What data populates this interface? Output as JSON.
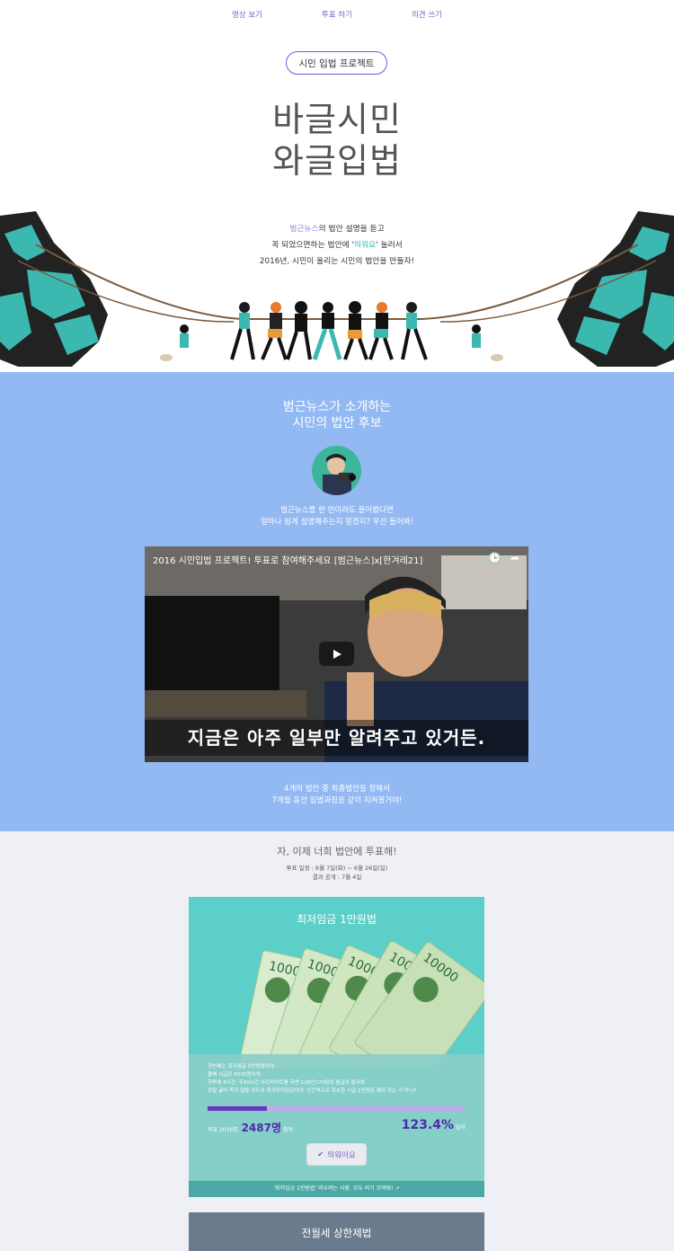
{
  "nav": {
    "items": [
      "영상 보기",
      "투표 하기",
      "의견 쓰기"
    ]
  },
  "hero": {
    "pill": "시민 입법 프로젝트",
    "title_line1": "바글시민",
    "title_line2": "와글입법",
    "desc_line1_purple": "범근뉴스",
    "desc_line1_rest": "의 법안 설명을 듣고",
    "desc_line2_pre": "꼭 되었으면하는 법안에 '",
    "desc_line2_teal": "띄워요",
    "desc_line2_post": "' 눌러서",
    "desc_line3": "2016년, 시민이 올리는 시민의 법안을 만들자!"
  },
  "intro": {
    "title_line1": "범근뉴스가 소개하는",
    "title_line2": "시민의 법안 후보",
    "sub_line1": "범근뉴스를 한 번이라도 들어봤다면",
    "sub_line2": "얼마나 쉽게 설명해주는지 알겠지? 우선 들어봐!",
    "video_title": "2016 시민입법 프로젝트! 투표로 참여해주세요 [범근뉴스]x[한겨레21]",
    "video_subtitle": "지금은 아주 일부만 알려주고 있거든.",
    "foot_line1": "4개의 법안 중 최종법안을 정해서",
    "foot_line2": "7개월 동안 입법과정을 같이 지켜볼거야!"
  },
  "vote": {
    "title": "자, 이제 너희 법안에 투표해!",
    "dates_line1": "투표 일정 : 6월 7일(화) ~ 6월 26일(일)",
    "dates_line2": "결과 공개 : 7월 4일",
    "cards": [
      {
        "title": "최저임금 1만원법",
        "text_line1": "첫번째는 최저임금 1만원법이야.",
        "text_line2": "올해 시급은 6030원이야.",
        "text_line3": "하루에 8시간, 주40시간 아르바이트를 하면 126만270원의 월급이 들어와.",
        "text_line4": "정말 굶어 죽지 않을 정도의 최저최저임금이야. 인간적으로 최소한 시급 1만원은 돼야 하는 거 아니?",
        "goal_label": "목표 2016명,",
        "participants": "2487명",
        "participants_suffix": "참여",
        "percent": "123.4%",
        "percent_suffix": "달성",
        "progress": 1.0,
        "progress_fill": 0.23,
        "button_label": "띄워어요",
        "footer": "'최저임금 1만원법' 띄우려는 사람, 모두 여기 모여봐! ↗"
      },
      {
        "title": "전월세 상한제법"
      }
    ]
  },
  "colors": {
    "accent": "#7d55d6",
    "blue_bg": "#93b9f3",
    "teal_card": "#5dcfc9",
    "progress_fill": "#6a34c6",
    "gray_card": "#6a7b8e"
  }
}
